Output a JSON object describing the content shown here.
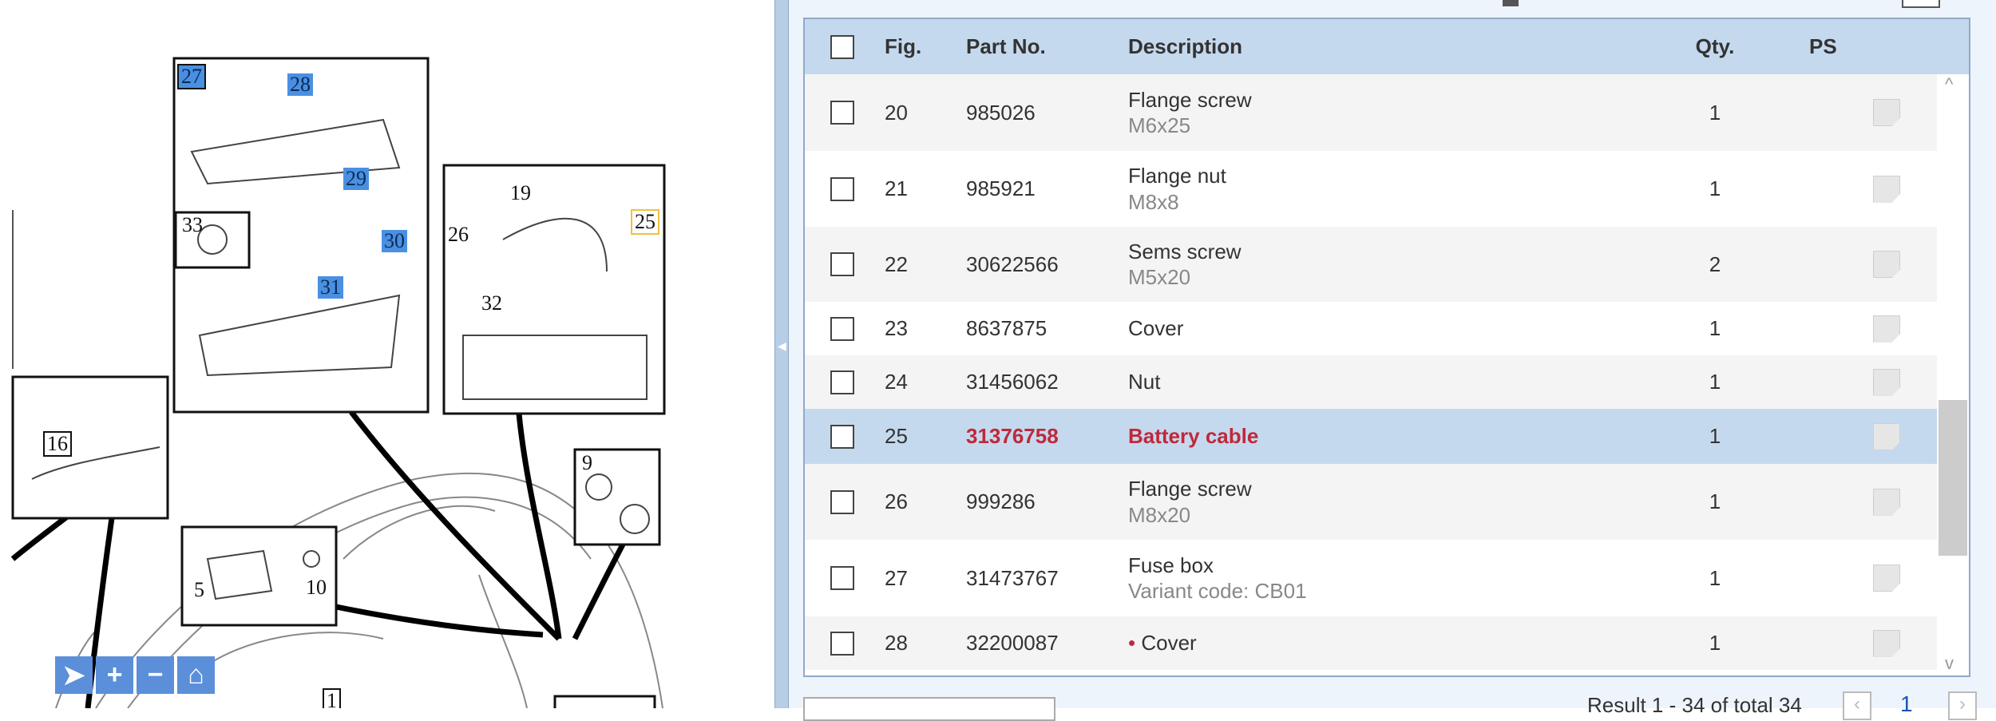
{
  "diagram": {
    "callouts": [
      "27",
      "28",
      "29",
      "30",
      "31",
      "33",
      "19",
      "26",
      "25",
      "32",
      "16",
      "9",
      "5",
      "10",
      "1"
    ],
    "highlighted": [
      "27",
      "28",
      "29",
      "30",
      "31"
    ],
    "selected": "25",
    "zoom_controls": [
      {
        "name": "select",
        "icon": "cursor-icon",
        "glyph": "➤"
      },
      {
        "name": "zoom-in",
        "icon": "plus-icon",
        "glyph": "+"
      },
      {
        "name": "zoom-out",
        "icon": "minus-icon",
        "glyph": "−"
      },
      {
        "name": "home",
        "icon": "home-icon",
        "glyph": "⌂"
      }
    ]
  },
  "table": {
    "headers": {
      "fig": "Fig.",
      "part": "Part No.",
      "desc": "Description",
      "qty": "Qty.",
      "ps": "PS"
    },
    "rows": [
      {
        "fig": "20",
        "part": "985026",
        "desc": "Flange screw",
        "sub": "M6x25",
        "qty": "1"
      },
      {
        "fig": "21",
        "part": "985921",
        "desc": "Flange nut",
        "sub": "M8x8",
        "qty": "1"
      },
      {
        "fig": "22",
        "part": "30622566",
        "desc": "Sems screw",
        "sub": "M5x20",
        "qty": "2"
      },
      {
        "fig": "23",
        "part": "8637875",
        "desc": "Cover",
        "sub": "",
        "qty": "1"
      },
      {
        "fig": "24",
        "part": "31456062",
        "desc": "Nut",
        "sub": "",
        "qty": "1"
      },
      {
        "fig": "25",
        "part": "31376758",
        "desc": "Battery cable",
        "sub": "",
        "qty": "1",
        "selected": true
      },
      {
        "fig": "26",
        "part": "999286",
        "desc": "Flange screw",
        "sub": "M8x20",
        "qty": "1"
      },
      {
        "fig": "27",
        "part": "31473767",
        "desc": "Fuse box",
        "sub": "Variant code: CB01",
        "qty": "1"
      },
      {
        "fig": "28",
        "part": "32200087",
        "desc": "Cover",
        "sub": "",
        "qty": "1",
        "bullet": "•"
      }
    ]
  },
  "footer": {
    "result": "Result 1 - 34 of total 34",
    "page": "1",
    "prev": "‹",
    "next": "›"
  },
  "colors": {
    "header": "#c5d9ee",
    "selected_text": "#c0283a",
    "highlight": "#4a90e2"
  }
}
